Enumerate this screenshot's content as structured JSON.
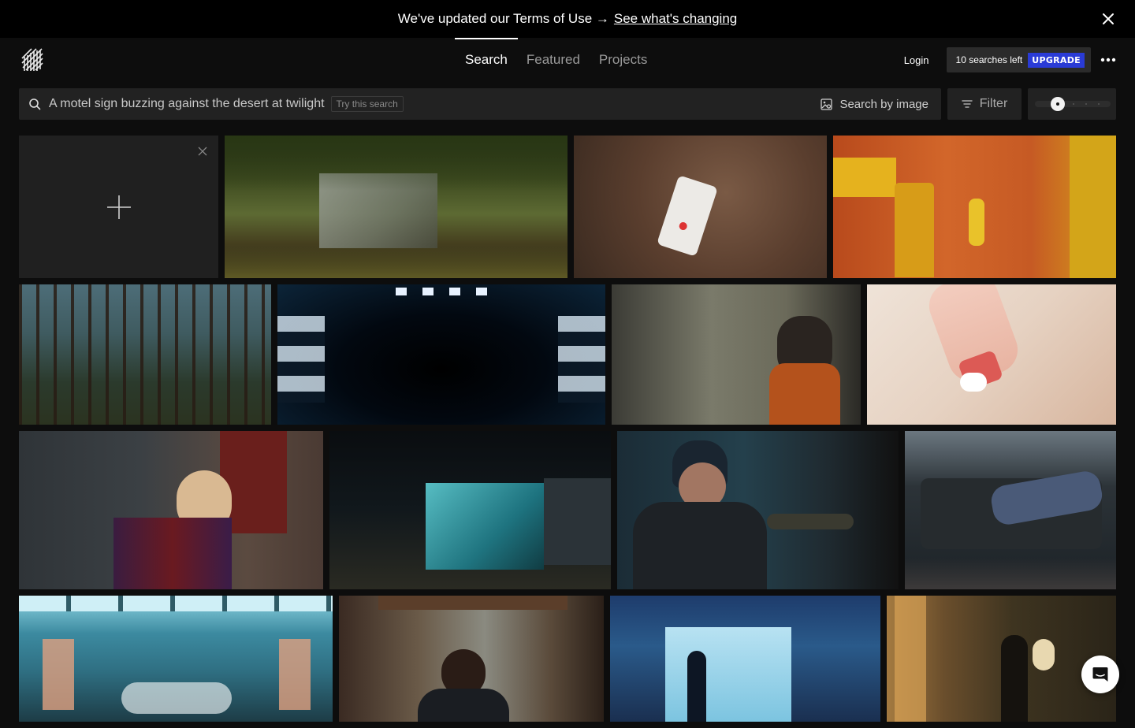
{
  "banner": {
    "text": "We've updated our Terms of Use →",
    "link": "See what's changing"
  },
  "nav": {
    "tabs": [
      {
        "label": "Search",
        "active": true
      },
      {
        "label": "Featured",
        "active": false
      },
      {
        "label": "Projects",
        "active": false
      }
    ]
  },
  "account": {
    "login_label": "Login",
    "searches_left": "10 searches left",
    "upgrade_label": "UPGRADE"
  },
  "search": {
    "query": "A motel sign buzzing against the desert at twilight",
    "try_label": "Try this search",
    "by_image_label": "Search by image",
    "filter_label": "Filter"
  },
  "thumbnail_size": 0.3,
  "colors": {
    "accent": "#2a3bd6",
    "background": "#0d0d0d",
    "panel": "#222222"
  },
  "gallery": {
    "rows": [
      [
        {
          "kind": "upload"
        },
        {
          "name": "glass-cabin-in-forest"
        },
        {
          "name": "phone-on-brown-cushion"
        },
        {
          "name": "woman-in-orange-kitchen"
        }
      ],
      [
        {
          "name": "pine-forest"
        },
        {
          "name": "dark-sci-fi-corridor"
        },
        {
          "name": "woman-feet-on-dashboard"
        },
        {
          "name": "hand-squeezing-cream-tube"
        }
      ],
      [
        {
          "name": "woman-laughing-on-couch"
        },
        {
          "name": "night-food-stall"
        },
        {
          "name": "chef-plating-dish"
        },
        {
          "name": "couple-lying-on-couch"
        }
      ],
      [
        {
          "name": "blue-conference-room"
        },
        {
          "name": "man-in-suit-at-meeting"
        },
        {
          "name": "silhouette-in-photo-studio"
        },
        {
          "name": "woman-by-vanity-mirror"
        }
      ]
    ]
  }
}
